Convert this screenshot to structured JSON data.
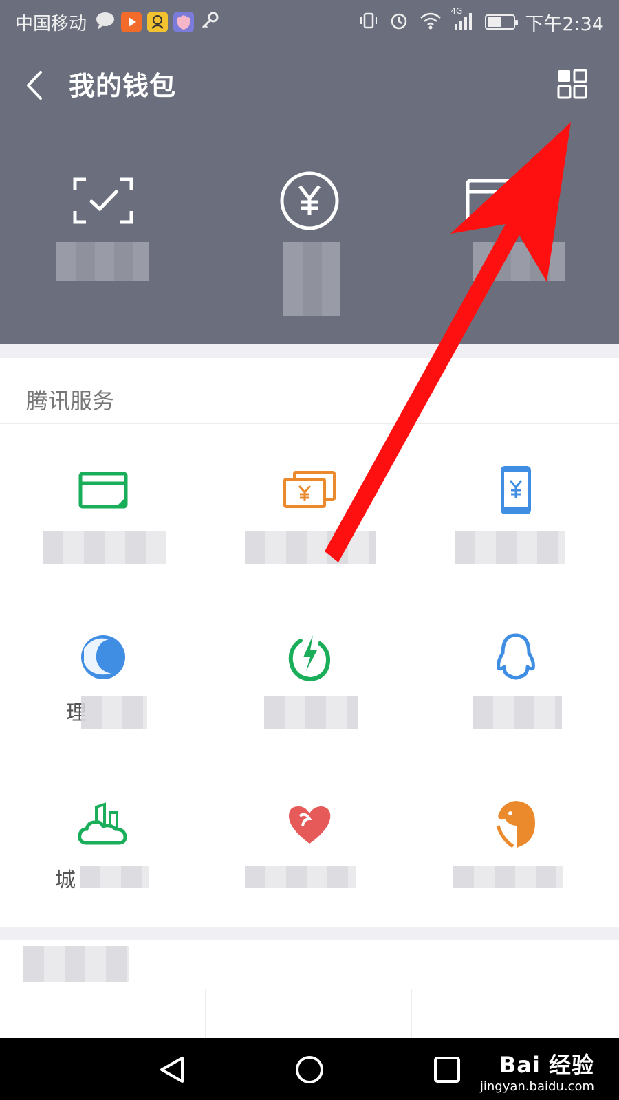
{
  "status_bar": {
    "carrier": "中国移动",
    "time": "下午2:34",
    "network": "4G",
    "battery_level": 0.55,
    "notification_icons": [
      "chat-bubble-icon",
      "video-app-icon",
      "qq-app-icon",
      "shield-app-icon",
      "key-icon"
    ],
    "colors": {
      "video": "#f26b2b",
      "qq": "#f2c230",
      "shield": "#7b7bd9"
    }
  },
  "header": {
    "title": "我的钱包",
    "background": "#6b6f7d",
    "tiles": [
      {
        "icon": "scan-check-icon"
      },
      {
        "icon": "yuan-circle-icon"
      },
      {
        "icon": "card-icon"
      }
    ]
  },
  "services": {
    "section_title": "腾讯服务",
    "rows": [
      [
        {
          "icon": "card-transfer-icon",
          "color": "#1aad5a",
          "label_visible": ""
        },
        {
          "icon": "yuan-bills-icon",
          "color": "#ea8a2c",
          "label_visible": ""
        },
        {
          "icon": "phone-yuan-icon",
          "color": "#3f8ee3",
          "label_visible": ""
        }
      ],
      [
        {
          "icon": "wealth-wave-icon",
          "color": "#3f8ee3",
          "label_visible": "理"
        },
        {
          "icon": "lightning-refresh-icon",
          "color": "#1aad5a",
          "label_visible": ""
        },
        {
          "icon": "qq-penguin-icon",
          "color": "#3f8ee3",
          "label_visible": ""
        }
      ],
      [
        {
          "icon": "city-cloud-icon",
          "color": "#1aad5a",
          "label_visible": "城"
        },
        {
          "icon": "heart-icon",
          "color": "#e65a5a",
          "label_visible": ""
        },
        {
          "icon": "penguin-profile-icon",
          "color": "#ea8a2c",
          "label_visible": ""
        }
      ]
    ]
  },
  "watermark": {
    "brand": "Bai 经验",
    "url": "jingyan.baidu.com"
  },
  "annotation": {
    "color": "#ff1010"
  }
}
